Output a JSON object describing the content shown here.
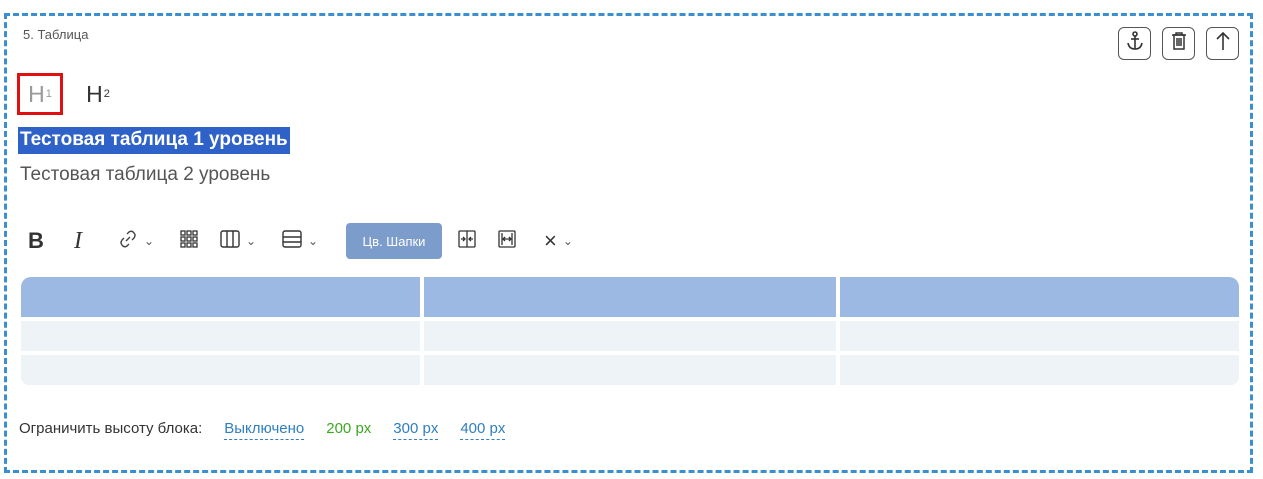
{
  "block": {
    "title": "5. Таблица",
    "actions": [
      {
        "name": "anchor-icon"
      },
      {
        "name": "trash-icon"
      },
      {
        "name": "arrow-up-icon"
      }
    ],
    "accent_color": "#3a8fd0"
  },
  "headings": {
    "h1": {
      "letter": "H",
      "index": "1"
    },
    "h2": {
      "letter": "H",
      "index": "2"
    }
  },
  "content": {
    "level1": "Тестовая таблица 1 уровень",
    "level2": "Тестовая таблица 2 уровень"
  },
  "toolbar": {
    "bold": "B",
    "italic": "I",
    "header_color_label": "Цв. Шапки",
    "caret": "⌄",
    "clear": "×"
  },
  "table": {
    "columns": 3,
    "rows": 2,
    "header_color": "#9cb9e3",
    "row_color": "#eef3f8"
  },
  "height_limit": {
    "label": "Ограничить высоту блока:",
    "options": [
      "Выключено",
      "200 px",
      "300 px",
      "400 px"
    ],
    "active_option": "200 px"
  }
}
